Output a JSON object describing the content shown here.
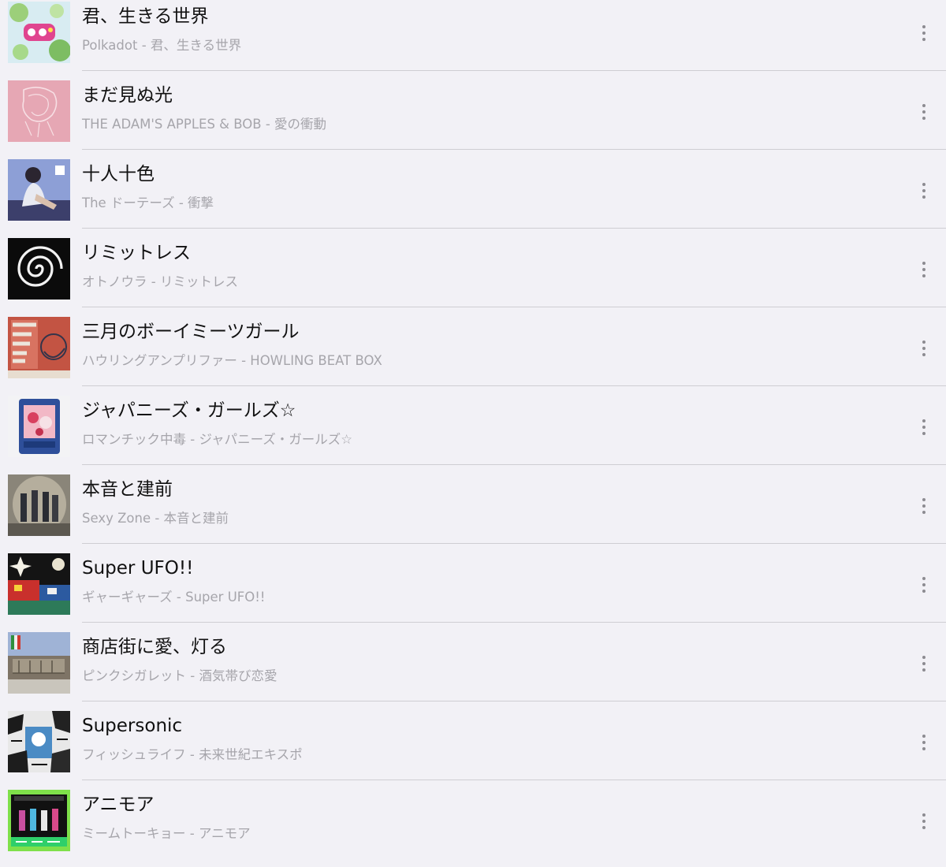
{
  "tracks": [
    {
      "title": "君、生きる世界",
      "subtitle": "Polkadot - 君、生きる世界",
      "artwork": "album-art-polkadot"
    },
    {
      "title": "まだ見ぬ光",
      "subtitle": "THE ADAM'S APPLES & BOB - 愛の衝動",
      "artwork": "album-art-pink-sketch"
    },
    {
      "title": "十人十色",
      "subtitle": "The ドーテーズ - 衝撃",
      "artwork": "album-art-photo-person"
    },
    {
      "title": "リミットレス",
      "subtitle": "オトノウラ - リミットレス",
      "artwork": "album-art-black-swirl"
    },
    {
      "title": "三月のボーイミーツガール",
      "subtitle": "ハウリングアンプリファー - HOWLING BEAT BOX",
      "artwork": "album-art-howling-beat-box"
    },
    {
      "title": "ジャパニーズ・ガールズ☆",
      "subtitle": "ロマンチック中毒 - ジャパニーズ・ガールズ☆",
      "artwork": "album-art-pink-frame"
    },
    {
      "title": "本音と建前",
      "subtitle": "Sexy Zone - 本音と建前",
      "artwork": "album-art-group-photo"
    },
    {
      "title": "Super UFO!!",
      "subtitle": "ギャーギャーズ - Super UFO!!",
      "artwork": "album-art-colorful-collage"
    },
    {
      "title": "商店街に愛、灯る",
      "subtitle": "ピンクシガレット - 酒気帯び恋愛",
      "artwork": "album-art-street-photo"
    },
    {
      "title": "Supersonic",
      "subtitle": "フィッシュライフ - 未来世紀エキスポ",
      "artwork": "album-art-manga-collage"
    },
    {
      "title": "アニモア",
      "subtitle": "ミームトーキョー - アニモア",
      "artwork": "album-art-neon-stage"
    }
  ],
  "more_icon": "more-vertical-icon",
  "colors": {
    "background": "#f2f1f6",
    "title": "#111111",
    "subtitle": "#a6a5ab",
    "separator": "#cfced3"
  }
}
